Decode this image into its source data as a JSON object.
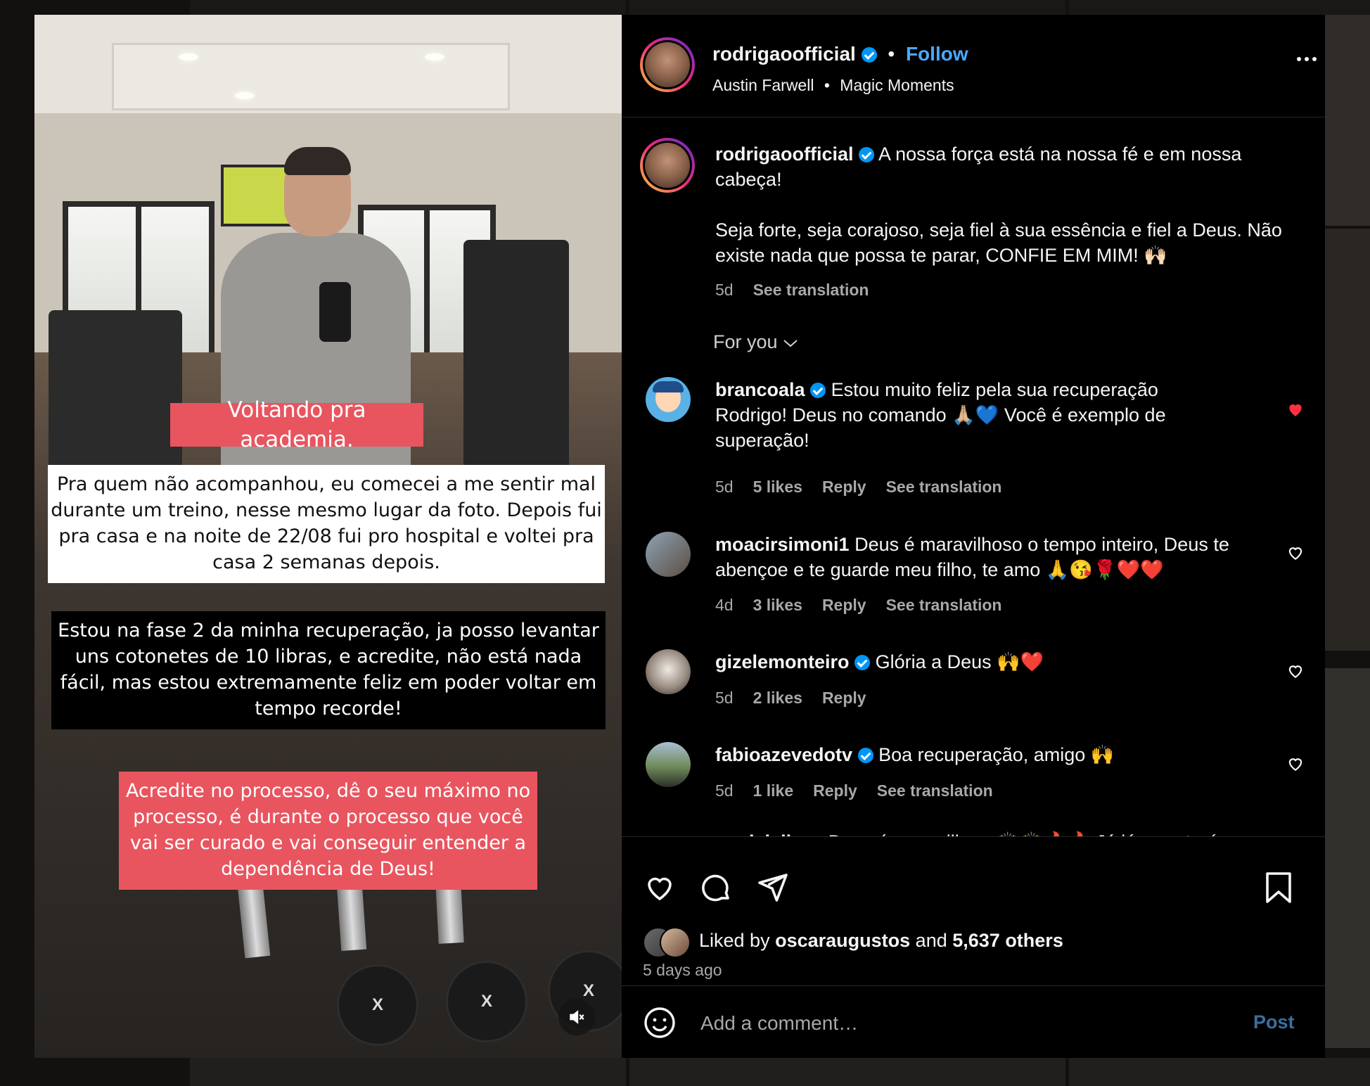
{
  "post": {
    "username": "rodrigaoofficial",
    "separator": "•",
    "follow_label": "Follow",
    "audio_artist": "Austin Farwell",
    "audio_track": "Magic Moments",
    "caption_line1": "A nossa força está na nossa fé e em nossa cabeça!",
    "caption_line2": "Seja forte, seja corajoso, seja fiel à sua essência e fiel a Deus. Não existe nada que possa te parar, CONFIE EM MIM! 🙌🏻",
    "caption_time": "5d",
    "see_translation": "See translation"
  },
  "media": {
    "caption_title": "Voltando pra academia.",
    "caption_block1": "Pra quem não acompanhou, eu comecei a me sentir mal durante um treino, nesse mesmo lugar da foto. Depois fui pra casa e na noite de 22/08 fui pro hospital e voltei pra casa 2 semanas depois.",
    "caption_block2": "Estou na fase 2 da minha recuperação, ja posso levantar uns cotonetes de 10 libras, e acredite, não está nada fácil, mas estou extremamente feliz em poder voltar em tempo recorde!",
    "caption_block3": "Acredite no processo, dê o seu máximo no processo, é durante o processo que você vai ser curado e vai conseguir entender a dependência de Deus!"
  },
  "for_you_label": "For you",
  "comments": [
    {
      "username": "brancoala",
      "text": "Estou muito feliz pela sua recuperação Rodrigo! Deus no comando 🙏🏼💙 Você é exemplo de superação!",
      "time": "5d",
      "likes": "5 likes",
      "reply": "Reply",
      "translation": "See translation",
      "liked": true
    },
    {
      "username": "moacirsimoni1",
      "text": "Deus é maravilhoso o tempo inteiro, Deus te abençoe e te guarde meu filho, te amo 🙏😘🌹❤️❤️",
      "time": "4d",
      "likes": "3 likes",
      "reply": "Reply",
      "translation": "See translation",
      "liked": false
    },
    {
      "username": "gizelemonteiro",
      "text": "Glória a Deus 🙌❤️",
      "time": "5d",
      "likes": "2 likes",
      "reply": "Reply",
      "liked": false
    },
    {
      "username": "fabioazevedotv",
      "text": "Boa recuperação, amigo 🙌",
      "time": "5d",
      "likes": "1 like",
      "reply": "Reply",
      "translation": "See translation",
      "liked": false
    },
    {
      "username": "carol_isilvaa",
      "text": "Deus é maravilhoso🙌🙌🔥🔥 Já já vc estará"
    }
  ],
  "likes": {
    "prefix": "Liked by",
    "by_user": "oscaraugustos",
    "and_word": "and",
    "others": "5,637 others",
    "date": "5 days ago"
  },
  "comment_box": {
    "placeholder": "Add a comment…",
    "post_label": "Post"
  },
  "colors": {
    "accent_follow": "#4aa8ff",
    "liked_heart": "#ff3040",
    "verified": "#0095f6",
    "caption_pink": "#e8555f"
  }
}
